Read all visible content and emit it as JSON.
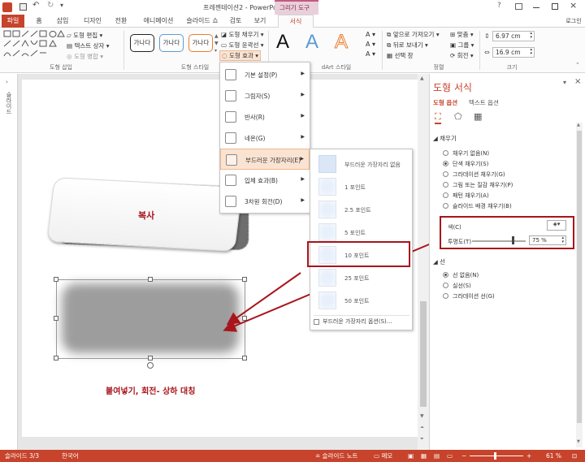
{
  "title_bar": {
    "title": "프레젠테이션2 - PowerPoint",
    "context_tab_group": "그리기 도구"
  },
  "tabs": {
    "file": "파일",
    "home": "홈",
    "insert": "삽입",
    "design": "디자인",
    "transitions": "전환",
    "animations": "애니메이션",
    "slideshow": "슬라이드 쇼",
    "review": "검토",
    "view": "보기",
    "format": "서식",
    "login": "로그인"
  },
  "ribbon": {
    "insert_shapes": {
      "label": "도형 삽입",
      "edit_shape": "도형 편집",
      "text_box": "텍스트 상자",
      "merge_shapes": "도형 병합"
    },
    "shape_styles": {
      "label": "도형 스타일",
      "preset": "가나다",
      "fill": "도형 채우기",
      "outline": "도형 윤곽선",
      "effects": "도형 효과"
    },
    "wordart": {
      "label": "WordArt 스타일",
      "sample": "A",
      "partial_label": "dArt 스타일"
    },
    "arrange": {
      "label": "정렬",
      "bring_forward": "앞으로 가져오기",
      "send_backward": "뒤로 보내기",
      "selection_pane": "선택 창",
      "align": "맞춤",
      "group": "그룹",
      "rotate": "회전"
    },
    "size": {
      "label": "크기",
      "height": "6.97 cm",
      "width": "16.9 cm"
    }
  },
  "left_strip": {
    "label": "슬라이드"
  },
  "effects_menu": {
    "items": [
      {
        "label": "기본 설정(P)"
      },
      {
        "label": "그림자(S)"
      },
      {
        "label": "반사(R)"
      },
      {
        "label": "네온(G)"
      },
      {
        "label": "부드러운 가장자리(E)"
      },
      {
        "label": "입체 효과(B)"
      },
      {
        "label": "3차원 회전(D)"
      }
    ]
  },
  "soft_edges_submenu": {
    "items": [
      {
        "label": "부드러운 가장자리 없음"
      },
      {
        "label": "1 포인트"
      },
      {
        "label": "2.5 포인트"
      },
      {
        "label": "5 포인트"
      },
      {
        "label": "10 포인트"
      },
      {
        "label": "25 포인트"
      },
      {
        "label": "50 포인트"
      }
    ],
    "options": "부드러운 가장자리 옵션(S)..."
  },
  "slide": {
    "copy_label": "복사",
    "annotation": "붙여넣기, 회전- 상하 대칭"
  },
  "format_pane": {
    "title": "도형 서식",
    "tab_shape": "도형 옵션",
    "tab_text": "텍스트 옵션",
    "fill_section": "채우기",
    "fill_options": [
      "채우기 없음(N)",
      "단색 채우기(S)",
      "그라데이션 채우기(G)",
      "그림 또는 질감 채우기(P)",
      "패턴 채우기(A)",
      "슬라이드 배경 채우기(B)"
    ],
    "color_label": "색(C)",
    "transparency_label": "투명도(T)",
    "transparency_value": "75 %",
    "transparency_level": 0.75,
    "line_section": "선",
    "line_options": [
      "선 없음(N)",
      "실선(S)",
      "그라데이션 선(G)"
    ]
  },
  "status": {
    "slide": "슬라이드 3/3",
    "lang": "한국어",
    "notes": "슬라이드 노트",
    "comments": "메모",
    "zoom": "61 %"
  },
  "colors": {
    "accent": "#c7432b",
    "highlight_box": "#a8151c",
    "menu_hover": "#fbe3d2"
  }
}
